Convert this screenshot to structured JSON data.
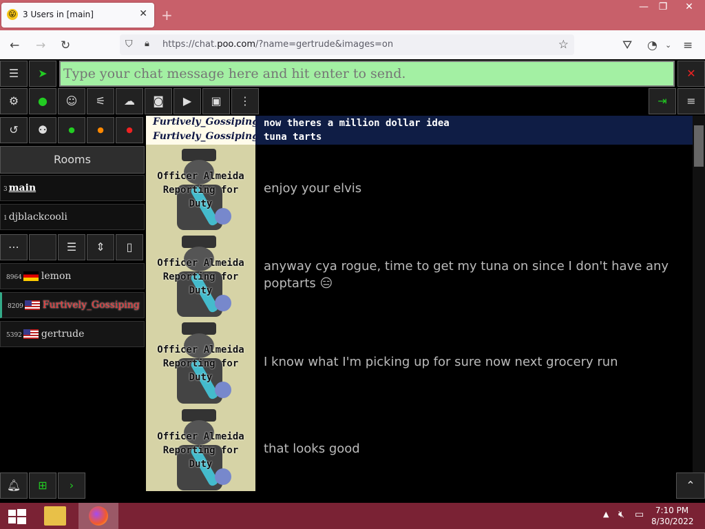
{
  "browser": {
    "tab_title": "3 Users in [main]",
    "url_scheme": "https://chat.",
    "url_host": "poo.com",
    "url_path": "/?name=gertrude&images=on"
  },
  "chat_input": {
    "placeholder": "Type your chat message here and hit enter to send."
  },
  "sidebar": {
    "rooms_header": "Rooms",
    "rooms": [
      {
        "count": "3",
        "name": "main"
      },
      {
        "count": "1",
        "name": "djblackcooli"
      }
    ],
    "users": [
      {
        "id": "8964",
        "flag": "de",
        "name": "lemon"
      },
      {
        "id": "8209",
        "flag": "us",
        "name": "Furtively_Gossiping"
      },
      {
        "id": "5392",
        "flag": "us",
        "name": "gertrude"
      }
    ]
  },
  "messages": [
    {
      "nick": "Furtively_Gossiping",
      "text": "now theres a million dollar idea"
    },
    {
      "nick": "Furtively_Gossiping",
      "text": "tuna tarts"
    }
  ],
  "avatar_label": [
    "Officer Almeida",
    "Reporting for",
    "Duty"
  ],
  "avatar_messages": [
    "enjoy your elvis",
    "anyway cya rogue, time to get my tuna on since I don't have any poptarts",
    "I know what I'm picking up for sure now next grocery run",
    "that looks good"
  ],
  "emoji": "😑",
  "taskbar": {
    "time": "7:10 PM",
    "date": "8/30/2022"
  },
  "colors": {
    "input_bg": "#a3f0a3",
    "highlight_msg_bg": "#0f1d45",
    "taskbar": "#7a2234",
    "close_red": "#e22222"
  }
}
